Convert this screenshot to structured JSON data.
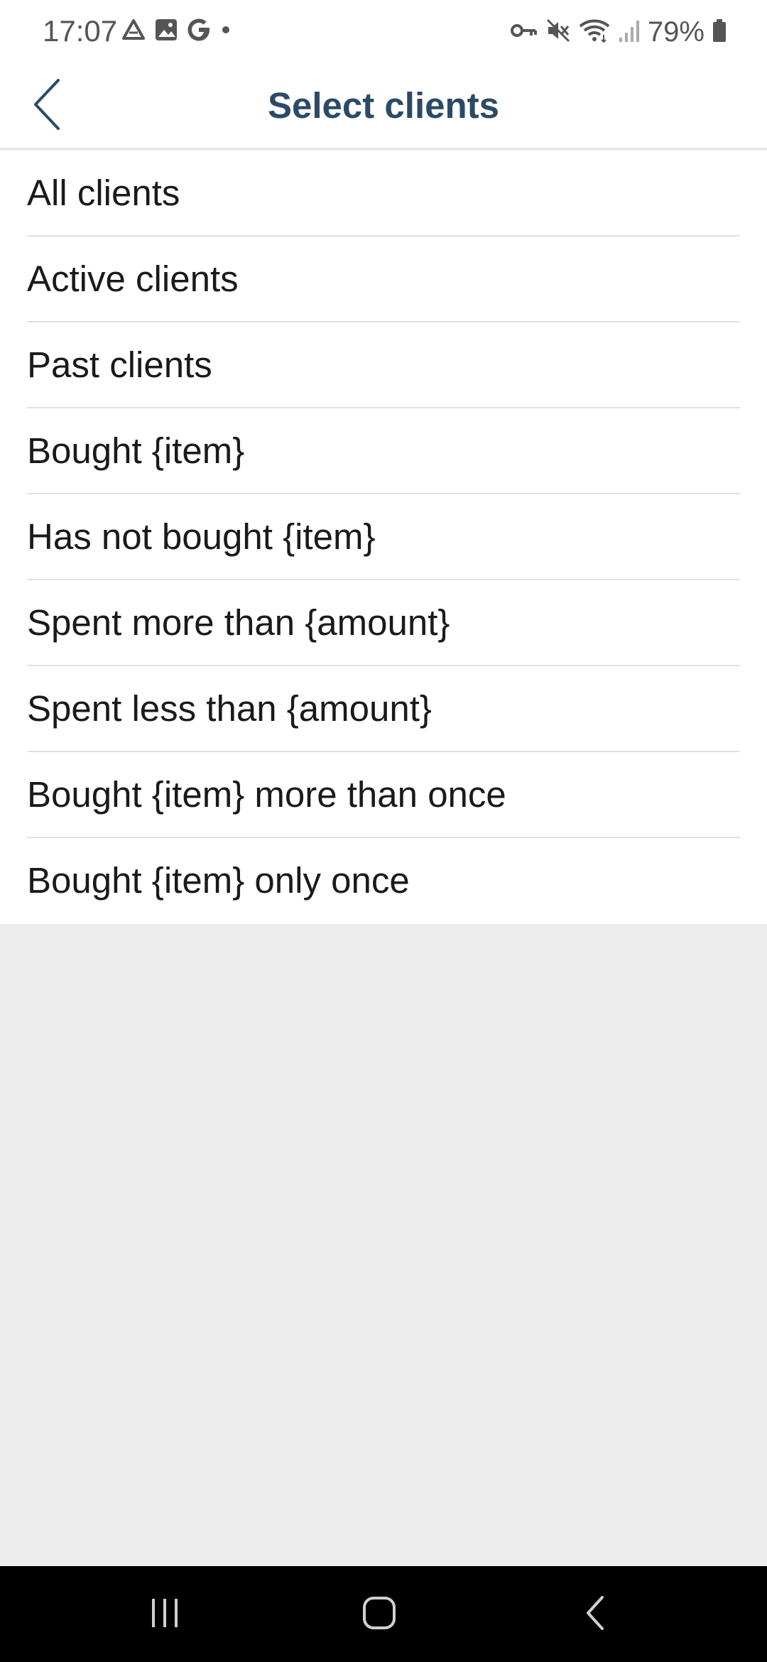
{
  "status_bar": {
    "time": "17:07",
    "left_icons": [
      "drive-icon",
      "image-icon",
      "google-icon",
      "dot-icon"
    ],
    "right_icons": [
      "vpn-key-icon",
      "mute-icon",
      "wifi-icon",
      "signal-icon",
      "battery-icon"
    ],
    "battery_percent": "79%"
  },
  "header": {
    "title": "Select clients",
    "back_icon": "chevron-left-icon",
    "accent_color": "#2c4a66"
  },
  "client_filters": [
    {
      "label": "All clients"
    },
    {
      "label": "Active clients"
    },
    {
      "label": "Past clients"
    },
    {
      "label": "Bought {item}"
    },
    {
      "label": "Has not bought {item}"
    },
    {
      "label": "Spent more than {amount}"
    },
    {
      "label": "Spent less than {amount}"
    },
    {
      "label": "Bought {item} more than once"
    },
    {
      "label": "Bought {item} only once"
    }
  ],
  "nav_bar": {
    "buttons": [
      "recent-apps-icon",
      "home-icon",
      "back-icon"
    ]
  }
}
